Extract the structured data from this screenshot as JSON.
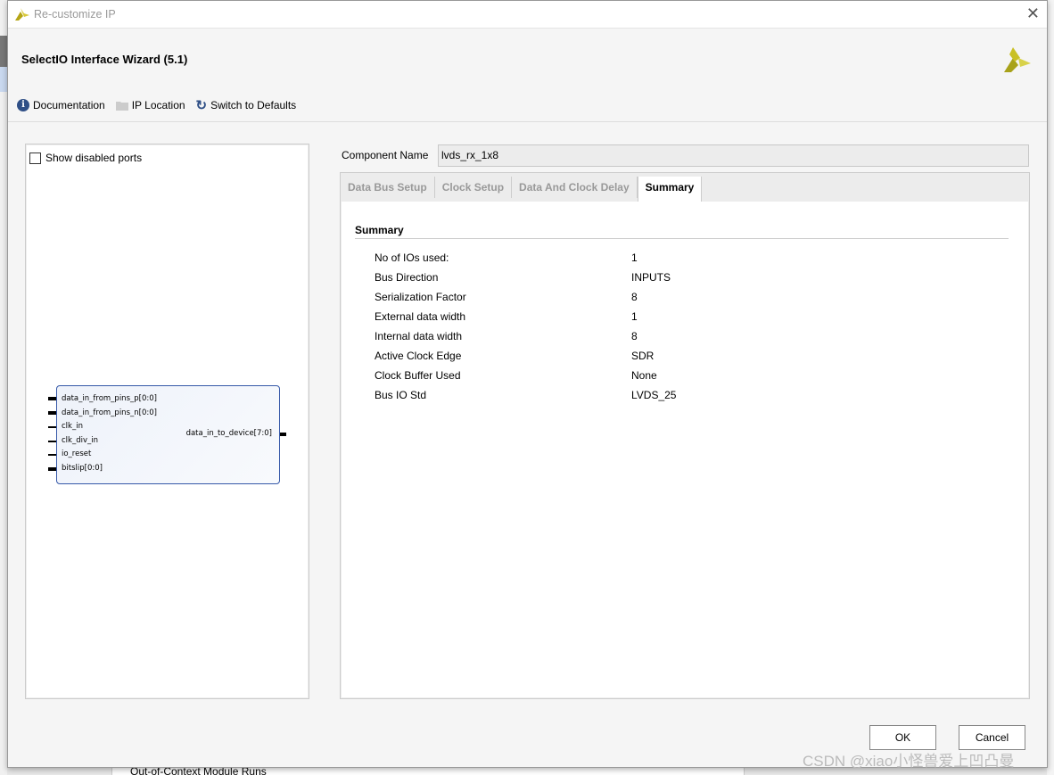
{
  "window": {
    "title": "Re-customize IP"
  },
  "wizard": {
    "title": "SelectIO Interface Wizard (5.1)"
  },
  "toolbar": {
    "documentation": "Documentation",
    "ip_location": "IP Location",
    "switch_defaults": "Switch to Defaults"
  },
  "left": {
    "show_disabled": "Show disabled ports",
    "block": {
      "inputs": [
        "data_in_from_pins_p[0:0]",
        "data_in_from_pins_n[0:0]",
        "clk_in",
        "clk_div_in",
        "io_reset",
        "bitslip[0:0]"
      ],
      "output": "data_in_to_device[7:0]"
    }
  },
  "component": {
    "label": "Component Name",
    "value": "lvds_rx_1x8"
  },
  "tabs": [
    "Data Bus Setup",
    "Clock Setup",
    "Data And Clock Delay",
    "Summary"
  ],
  "summary": {
    "heading": "Summary",
    "rows": [
      {
        "label": "No of IOs used:",
        "value": "1"
      },
      {
        "label": "Bus Direction",
        "value": "INPUTS"
      },
      {
        "label": "Serialization Factor",
        "value": "8"
      },
      {
        "label": "External data width",
        "value": "1"
      },
      {
        "label": "Internal data width",
        "value": "8"
      },
      {
        "label": "Active Clock Edge",
        "value": "SDR"
      },
      {
        "label": "Clock Buffer Used",
        "value": "None"
      },
      {
        "label": "Bus IO Std",
        "value": "LVDS_25"
      }
    ]
  },
  "buttons": {
    "ok": "OK",
    "cancel": "Cancel"
  },
  "background": {
    "bottom_item": "Out-of-Context Module Runs"
  },
  "watermark": "CSDN @xiao小怪兽爱上凹凸曼"
}
